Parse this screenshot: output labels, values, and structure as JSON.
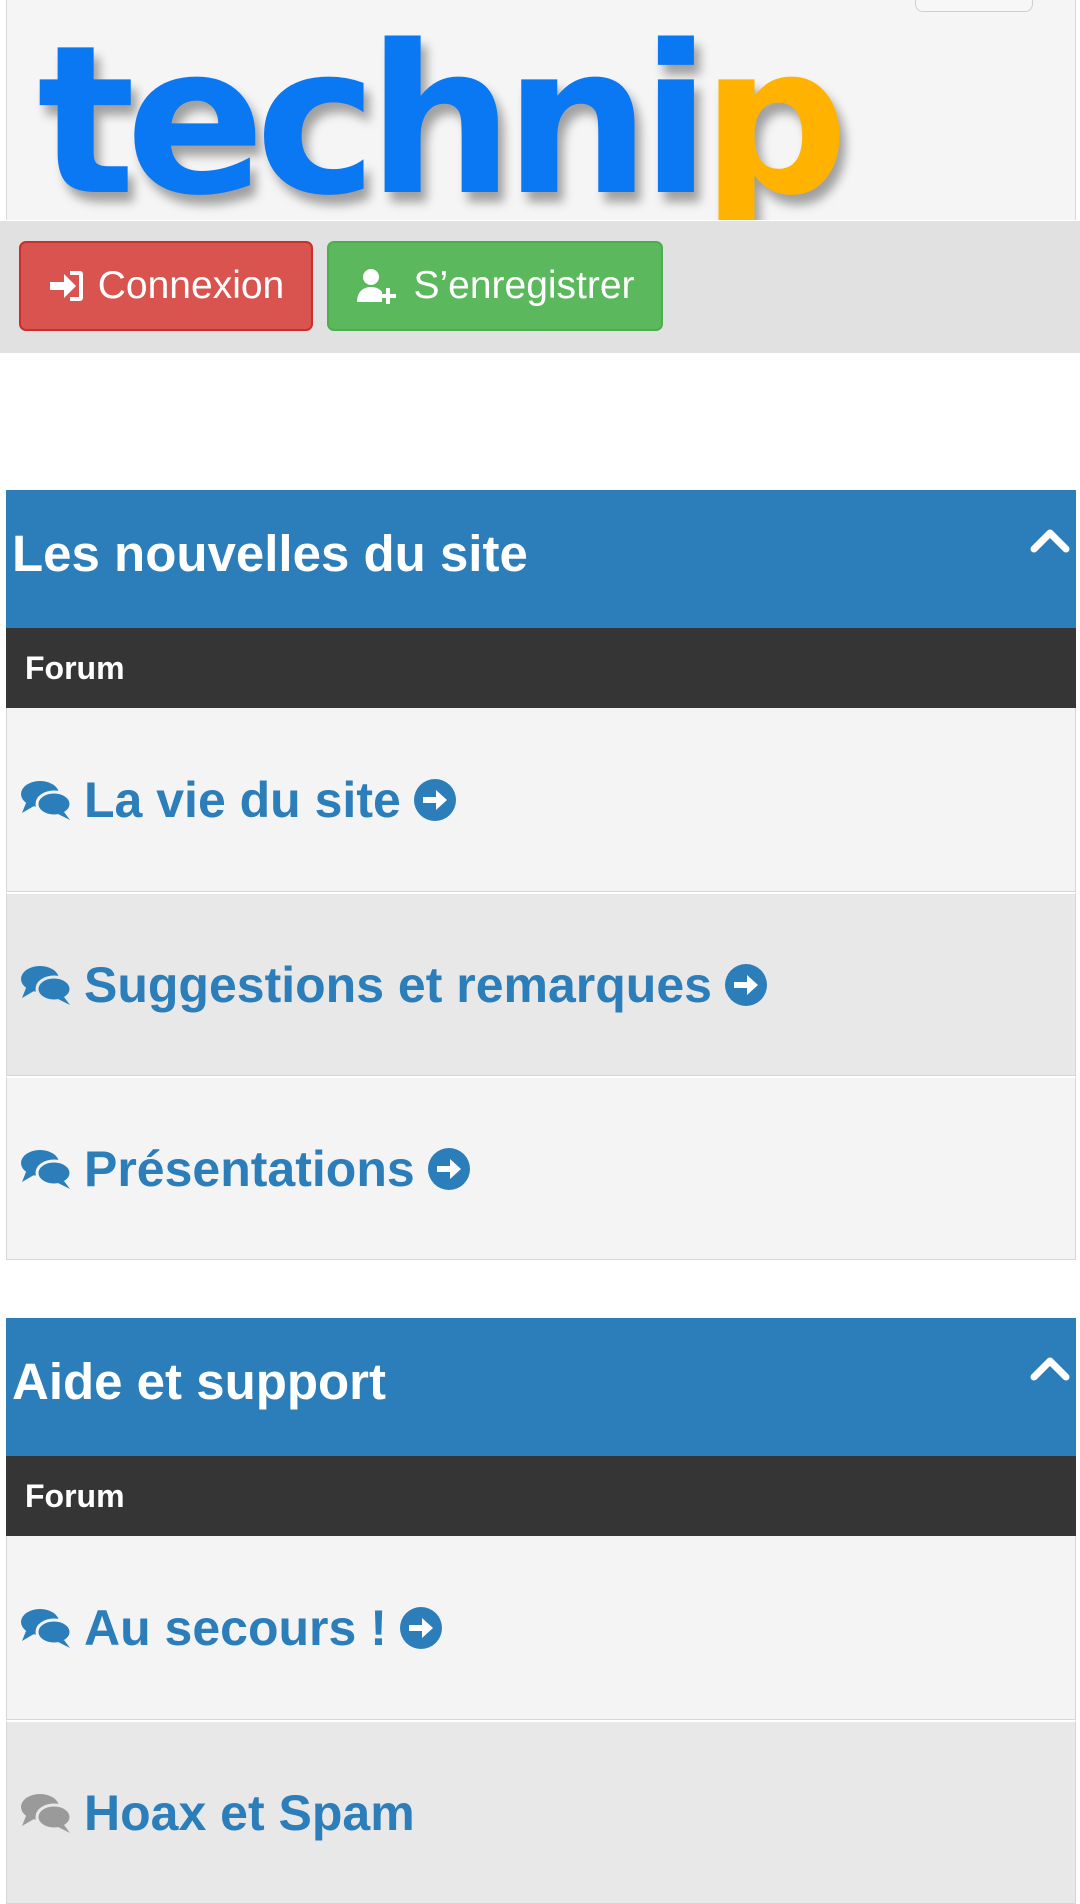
{
  "header": {
    "logo_text": "techni",
    "logo_accent": "p",
    "brand_color": "#0a78f2",
    "accent_color": "#ffb300"
  },
  "auth": {
    "login_label": "Connexion",
    "register_label": "S’enregistrer",
    "login_color": "#d9534f",
    "register_color": "#5cb85c"
  },
  "categories": [
    {
      "title": "Les nouvelles du site",
      "column_label": "Forum",
      "forums": [
        {
          "name": "La vie du site",
          "icon": "comments-icon",
          "arrow": "arrow-circle-right-icon"
        },
        {
          "name": "Suggestions et remarques",
          "icon": "comments-icon",
          "arrow": "arrow-circle-right-icon"
        },
        {
          "name": "Présentations",
          "icon": "comments-icon",
          "arrow": "arrow-circle-right-icon"
        }
      ]
    },
    {
      "title": "Aide et support",
      "column_label": "Forum",
      "forums": [
        {
          "name": "Au secours !",
          "icon": "comments-icon",
          "arrow": "arrow-circle-right-icon"
        },
        {
          "name": "Hoax et Spam",
          "icon": "comments-icon-muted"
        }
      ]
    }
  ],
  "colors": {
    "category_header": "#2b7eb9",
    "column_header": "#353535",
    "link": "#2b7eb9"
  }
}
